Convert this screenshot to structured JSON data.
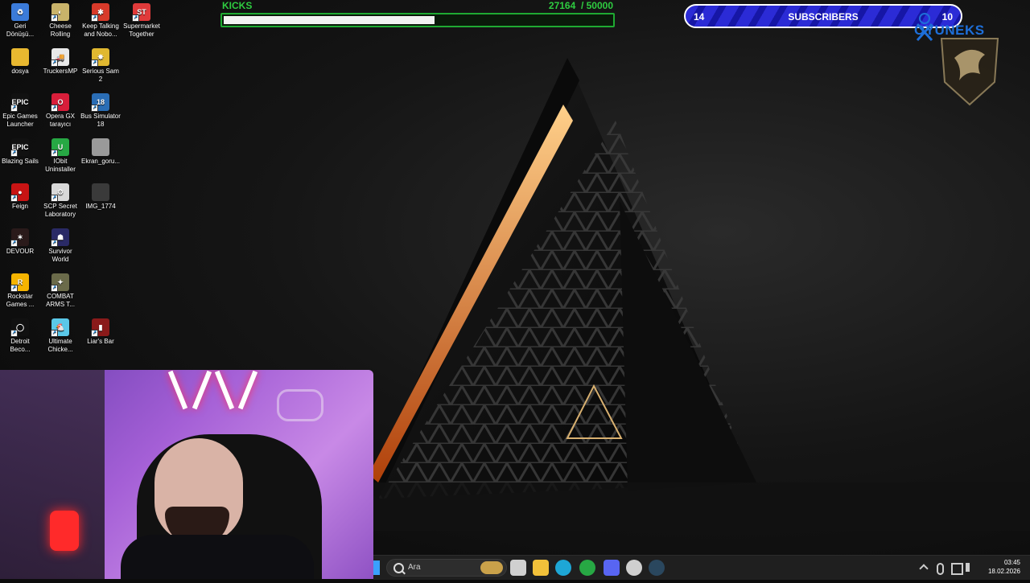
{
  "desktop": {
    "icons": [
      {
        "label": "Geri Dönüşü...",
        "color": "#3b7bd9",
        "glyph": "♻"
      },
      {
        "label": "Cheese Rolling",
        "color": "#c9b36a",
        "glyph": "◐"
      },
      {
        "label": "Keep Talking and Nobo...",
        "color": "#d83a2a",
        "glyph": "✱"
      },
      {
        "label": "Supermarket Together",
        "color": "#e03a3a",
        "glyph": "ST"
      },
      {
        "label": "dosya",
        "color": "#e8b830",
        "glyph": ""
      },
      {
        "label": "TruckersMP",
        "color": "#e8e8e8",
        "glyph": "🚚"
      },
      {
        "label": "Serious Sam 2",
        "color": "#e0b830",
        "glyph": "✸"
      },
      {
        "label": "Epic Games Launcher",
        "color": "#111111",
        "glyph": "EPIC"
      },
      {
        "label": "Opera GX tarayıcı",
        "color": "#d81e3a",
        "glyph": "O"
      },
      {
        "label": "Bus Simulator 18",
        "color": "#2a6db5",
        "glyph": "18"
      },
      {
        "label": "Blazing Sails",
        "color": "#111111",
        "glyph": "EPIC"
      },
      {
        "label": "IObit Uninstaller",
        "color": "#27a844",
        "glyph": "U"
      },
      {
        "label": "Ekran_goru...",
        "color": "#9a9a9a",
        "glyph": ""
      },
      {
        "label": "Feign",
        "color": "#c81414",
        "glyph": "●"
      },
      {
        "label": "SCP Secret Laboratory",
        "color": "#d8d8d8",
        "glyph": "⚙"
      },
      {
        "label": "IMG_1774",
        "color": "#3a3a3a",
        "glyph": ""
      },
      {
        "label": "DEVOUR",
        "color": "#2a1a1a",
        "glyph": "✶"
      },
      {
        "label": "Survivor World",
        "color": "#2a2a66",
        "glyph": "☗"
      },
      {
        "label": "Rockstar Games ...",
        "color": "#f5b400",
        "glyph": "R"
      },
      {
        "label": "COMBAT ARMS T...",
        "color": "#6b6b4a",
        "glyph": "✦"
      },
      {
        "label": "Detroit Beco...",
        "color": "#111111",
        "glyph": "◯"
      },
      {
        "label": "Ultimate Chicke...",
        "color": "#5ac8e8",
        "glyph": "🐔"
      },
      {
        "label": "Liar's Bar",
        "color": "#8a1a1a",
        "glyph": "▮"
      }
    ]
  },
  "overlay": {
    "kicks": {
      "title": "KICKS",
      "current": "27164",
      "goal": "/ 50000",
      "progress": 0.543
    },
    "subscribers": {
      "left": "14",
      "label": "SUBSCRIBERS",
      "right": "10"
    },
    "brand": "OYUNEKS"
  },
  "taskbar": {
    "search_placeholder": "Ara",
    "apps": [
      {
        "name": "task-view",
        "color": "#d0d0d0"
      },
      {
        "name": "file-explorer",
        "color": "#f2c13a"
      },
      {
        "name": "edge",
        "color": "#1ea7d6"
      },
      {
        "name": "iobit",
        "color": "#27a844"
      },
      {
        "name": "discord",
        "color": "#5865f2"
      },
      {
        "name": "chrome-like",
        "color": "#cfcfcf"
      },
      {
        "name": "steam",
        "color": "#2a475e"
      }
    ],
    "time": "03:45",
    "date": "18.02.2026"
  }
}
